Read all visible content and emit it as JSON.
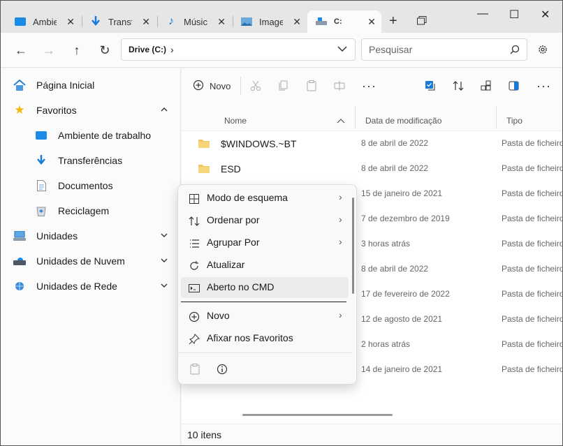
{
  "tabs": [
    {
      "label": "Ambie",
      "icon": "desktop-icon"
    },
    {
      "label": "Transf",
      "icon": "download-icon"
    },
    {
      "label": "Músic",
      "icon": "music-icon"
    },
    {
      "label": "Image",
      "icon": "image-icon"
    },
    {
      "label": "C:",
      "icon": "drive-icon",
      "active": true
    }
  ],
  "address": {
    "path": "Drive (C:)"
  },
  "search": {
    "placeholder": "Pesquisar"
  },
  "sidebar": {
    "items": [
      {
        "label": "Página Inicial",
        "icon": "home-icon"
      },
      {
        "label": "Favoritos",
        "icon": "star-icon",
        "expanded": true
      },
      {
        "label": "Ambiente de trabalho",
        "icon": "desktop-icon"
      },
      {
        "label": "Transferências",
        "icon": "download-icon"
      },
      {
        "label": "Documentos",
        "icon": "document-icon"
      },
      {
        "label": "Reciclagem",
        "icon": "recycle-bin-icon"
      },
      {
        "label": "Unidades",
        "icon": "drives-icon",
        "expanded": false
      },
      {
        "label": "Unidades de Nuvem",
        "icon": "cloud-drive-icon",
        "expanded": false
      },
      {
        "label": "Unidades de Rede",
        "icon": "network-drive-icon",
        "expanded": false
      }
    ]
  },
  "toolbar": {
    "new_label": "Novo"
  },
  "columns": {
    "name": "Nome",
    "modified": "Data de modificação",
    "type": "Tipo"
  },
  "files": [
    {
      "name": "$WINDOWS.~BT",
      "date": "8 de abril de 2022",
      "type": "Pasta de ficheiros"
    },
    {
      "name": "ESD",
      "date": "8 de abril de 2022",
      "type": "Pasta de ficheiros"
    },
    {
      "name": "",
      "date": "15 de janeiro de 2021",
      "type": "Pasta de ficheiros"
    },
    {
      "name": "",
      "date": "7 de dezembro de 2019",
      "type": "Pasta de ficheiros"
    },
    {
      "name": "",
      "date": "3 horas atrás",
      "type": "Pasta de ficheiros"
    },
    {
      "name": "",
      "date": "8 de abril de 2022",
      "type": "Pasta de ficheiros"
    },
    {
      "name": "",
      "date": "17 de fevereiro de 2022",
      "type": "Pasta de ficheiros"
    },
    {
      "name": "",
      "date": "12 de agosto de 2021",
      "type": "Pasta de ficheiros"
    },
    {
      "name": "",
      "date": "2 horas atrás",
      "type": "Pasta de ficheiros"
    },
    {
      "name": "",
      "date": "14 de janeiro de 2021",
      "type": "Pasta de ficheiros"
    }
  ],
  "status": {
    "count": "10 itens"
  },
  "context_menu": {
    "items": [
      {
        "label": "Modo de esquema",
        "icon": "layout-icon",
        "submenu": true
      },
      {
        "label": "Ordenar por",
        "icon": "sort-icon",
        "submenu": true
      },
      {
        "label": "Agrupar Por",
        "icon": "group-icon",
        "submenu": true
      },
      {
        "label": "Atualizar",
        "icon": "refresh-icon",
        "submenu": false
      },
      {
        "label": "Aberto no CMD",
        "icon": "terminal-icon",
        "submenu": false
      },
      {
        "label": "Novo",
        "icon": "new-icon",
        "submenu": true
      },
      {
        "label": "Afixar nos Favoritos",
        "icon": "pin-icon",
        "submenu": false
      }
    ]
  },
  "colors": {
    "accent": "#0067c0",
    "folder": "#f2c55c",
    "star": "#f5b70a"
  }
}
